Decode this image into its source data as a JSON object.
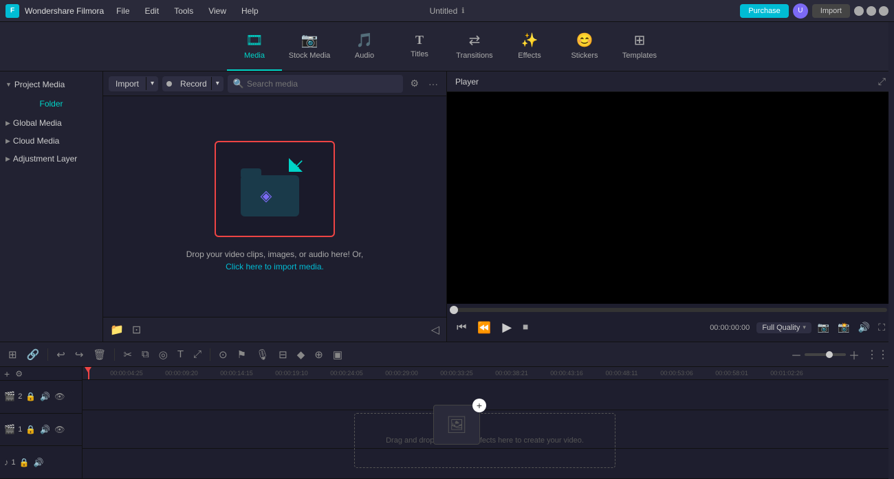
{
  "app": {
    "name": "Wondershare Filmora",
    "logo_char": "F",
    "project_title": "Untitled"
  },
  "titlebar": {
    "menu_items": [
      "File",
      "Edit",
      "Tools",
      "View",
      "Help"
    ],
    "purchase_label": "Purchase",
    "import_label": "Import",
    "win_controls": [
      "minimize",
      "maximize",
      "close"
    ]
  },
  "toolbar": {
    "items": [
      {
        "id": "media",
        "label": "Media",
        "icon": "🎞"
      },
      {
        "id": "stock",
        "label": "Stock Media",
        "icon": "📷"
      },
      {
        "id": "audio",
        "label": "Audio",
        "icon": "🎵"
      },
      {
        "id": "titles",
        "label": "Titles",
        "icon": "T"
      },
      {
        "id": "transitions",
        "label": "Transitions",
        "icon": "↔"
      },
      {
        "id": "effects",
        "label": "Effects",
        "icon": "✨"
      },
      {
        "id": "stickers",
        "label": "Stickers",
        "icon": "😊"
      },
      {
        "id": "templates",
        "label": "Templates",
        "icon": "⊞"
      }
    ],
    "active": "media"
  },
  "left_panel": {
    "project_media_label": "Project Media",
    "folder_label": "Folder",
    "global_media_label": "Global Media",
    "cloud_media_label": "Cloud Media",
    "adjustment_layer_label": "Adjustment Layer"
  },
  "media_toolbar": {
    "import_label": "Import",
    "record_label": "Record",
    "search_placeholder": "Search media"
  },
  "media_area": {
    "drop_text": "Drop your video clips, images, or audio here! Or,",
    "import_link_text": "Click here to import media."
  },
  "player": {
    "title": "Player",
    "timecode": "00:00:00:00",
    "quality_label": "Full Quality",
    "progress_percent": 0
  },
  "timeline": {
    "tools": [
      "undo",
      "redo",
      "delete",
      "split",
      "crop",
      "pen",
      "text",
      "adjust"
    ],
    "ruler_marks": [
      "00:00:04:25",
      "00:00:09:20",
      "00:00:14:15",
      "00:00:19:10",
      "00:00:24:05",
      "00:00:29:00",
      "00:00:33:25",
      "00:00:38:21",
      "00:00:43:16",
      "00:00:48:11",
      "00:00:53:06",
      "00:00:58:01",
      "00:01:02:26"
    ],
    "tracks": [
      {
        "icon": "🎬",
        "num": "2",
        "has_lock": true,
        "has_audio": true,
        "has_eye": true
      },
      {
        "icon": "🎬",
        "num": "1",
        "has_lock": true,
        "has_audio": true,
        "has_eye": true
      },
      {
        "icon": "🎵",
        "num": "1",
        "has_lock": true,
        "has_audio": true,
        "has_eye": false
      }
    ],
    "drop_text": "Drag and drop media and effects here to create your video.",
    "second_toolbar_icons": [
      "camera",
      "link",
      "snap",
      "timeline-settings",
      "split",
      "motion",
      "screen",
      "zoom-in",
      "zoom-out"
    ]
  }
}
